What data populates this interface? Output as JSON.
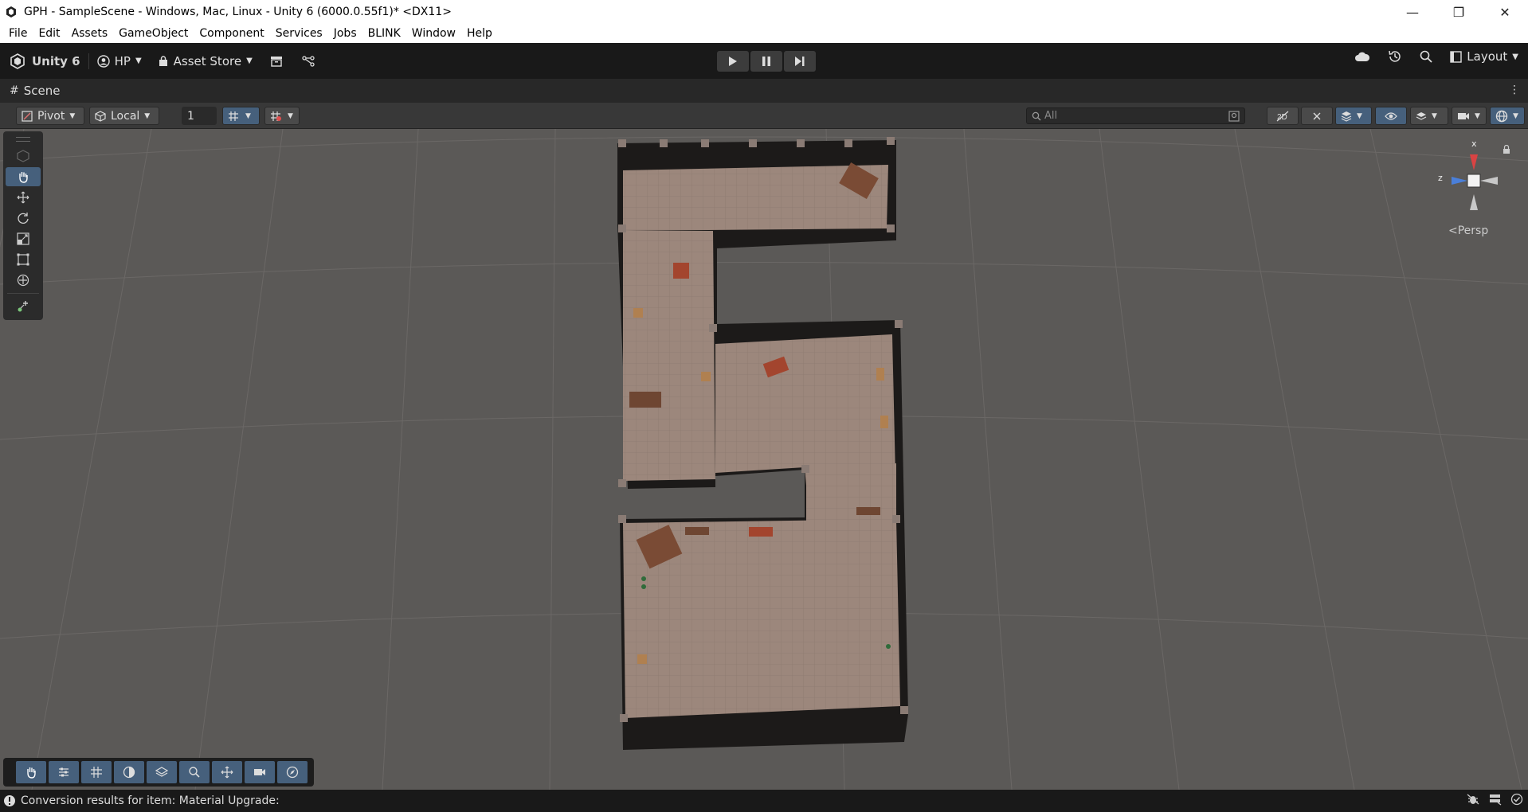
{
  "window": {
    "title": "GPH - SampleScene - Windows, Mac, Linux - Unity 6 (6000.0.55f1)* <DX11>",
    "controls": [
      "minimize",
      "restore",
      "close"
    ]
  },
  "menu": [
    "File",
    "Edit",
    "Assets",
    "GameObject",
    "Component",
    "Services",
    "Jobs",
    "BLINK",
    "Window",
    "Help"
  ],
  "toolbar": {
    "product": "Unity 6",
    "account": "HP",
    "asset_store": "Asset Store",
    "layout": "Layout"
  },
  "tab": {
    "scene": "Scene"
  },
  "scene_toolbar": {
    "pivot": "Pivot",
    "local": "Local",
    "grid_value": "1",
    "search_placeholder": "All"
  },
  "gizmo": {
    "x": "x",
    "z": "z",
    "projection": "Persp"
  },
  "status": {
    "message": "Conversion results for item: Material Upgrade:"
  },
  "colors": {
    "accent": "#46607c",
    "viewport": "#5b5957",
    "floor": "#9c877c",
    "wall": "#1a1a1a"
  }
}
